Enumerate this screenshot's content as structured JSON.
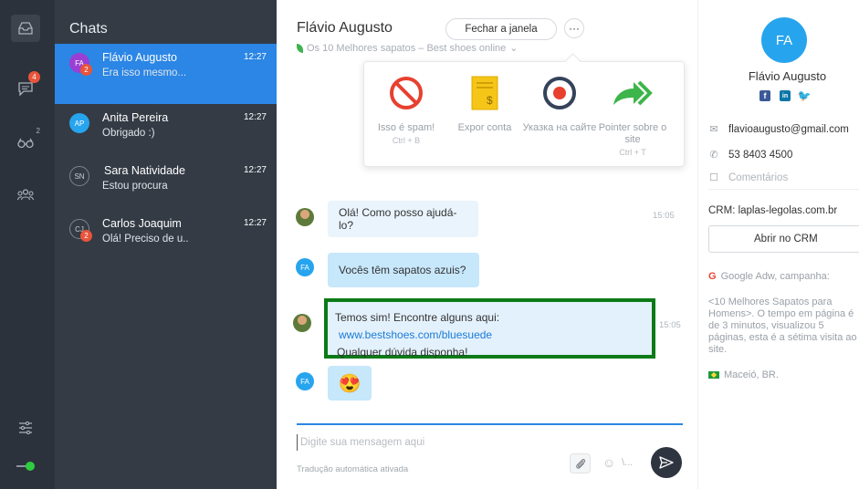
{
  "rail": {
    "items": [
      {
        "icon": "inbox-icon"
      },
      {
        "icon": "chat-icon",
        "badge": "4"
      },
      {
        "icon": "visitors-icon",
        "sup": "2"
      },
      {
        "icon": "team-icon"
      }
    ],
    "settings_icon": "settings-sliders-icon",
    "status": "online"
  },
  "chatlist": {
    "title": "Chats",
    "items": [
      {
        "initials": "FA",
        "name": "Flávio Augusto",
        "time": "12:27",
        "preview": "Era isso mesmo...",
        "badge": "2",
        "active": true,
        "avatar_color": "#9b3fd4"
      },
      {
        "initials": "AP",
        "name": "Anita Pereira",
        "time": "12:27",
        "preview": "Obrigado :)",
        "badge": "",
        "active": false,
        "avatar_color": "#27a4ee"
      },
      {
        "initials": "SN",
        "name": "Sara Natividade",
        "time": "12:27",
        "preview": "Estou procura",
        "badge": "",
        "active": false,
        "avatar_color": ""
      },
      {
        "initials": "CJ",
        "name": "Carlos Joaquim",
        "time": "12:27",
        "preview": "Olá! Preciso de u..",
        "badge": "2",
        "active": false,
        "avatar_color": ""
      }
    ]
  },
  "conversation": {
    "name": "Flávio Augusto",
    "source": "Os 10 Melhores sapatos – Best shoes online",
    "close_label": "Fechar a janela",
    "more_label": "···",
    "actions": [
      {
        "label": "Isso é spam!",
        "shortcut": "Ctrl + B",
        "icon": "spam-icon"
      },
      {
        "label": "Expor conta",
        "shortcut": "",
        "icon": "invoice-icon"
      },
      {
        "label": "Указка на сайте",
        "shortcut": "",
        "icon": "record-icon"
      },
      {
        "label": "Pointer sobre o site",
        "shortcut": "Ctrl + T",
        "icon": "share-arrow-icon"
      }
    ],
    "messages": [
      {
        "from": "agent",
        "text": "Olá! Como posso ajudá-lo?",
        "time": "15:05"
      },
      {
        "from": "visitor",
        "initials": "FA",
        "text": "Vocês têm sapatos azuis?"
      },
      {
        "from": "agent",
        "text": "Temos sim! Encontre alguns aqui:",
        "link": "www.bestshoes.com/bluesuede",
        "text2": "Qualquer dúvida disponha!",
        "time": "15:05"
      },
      {
        "from": "visitor",
        "initials": "FA",
        "emoji": "😍"
      }
    ],
    "composer_placeholder": "Digite sua mensagem aqui",
    "emoji_more": "\\...",
    "translation_note": "Tradução automática ativada"
  },
  "visitor": {
    "initials": "FA",
    "name": "Flávio Augusto",
    "email": "flavioaugusto@gmail.com",
    "phone": "53 8403 4500",
    "comments_placeholder": "Comentários",
    "crm_label": "CRM: laplas-legolas.com.br",
    "crm_button": "Abrir no CRM",
    "campaign_label": "Google Adw, campanha:",
    "campaign_text": "<10 Melhores Sapatos para Homens>. O tempo em página é de 3 minutos, visualizou 5 páginas, esta é a sétima visita ao site.",
    "location": "Maceió, BR.",
    "social": [
      {
        "letter": "f",
        "color": "#3b5998"
      },
      {
        "letter": "in",
        "color": "#0e76a8"
      },
      {
        "letter": "t",
        "color": "#1da1f2"
      }
    ]
  },
  "colors": {
    "accent": "#2b86e5",
    "sidebar": "#343b45",
    "rail": "#2c323b",
    "highlight_border": "#0c7a17",
    "badge": "#e8543a"
  }
}
